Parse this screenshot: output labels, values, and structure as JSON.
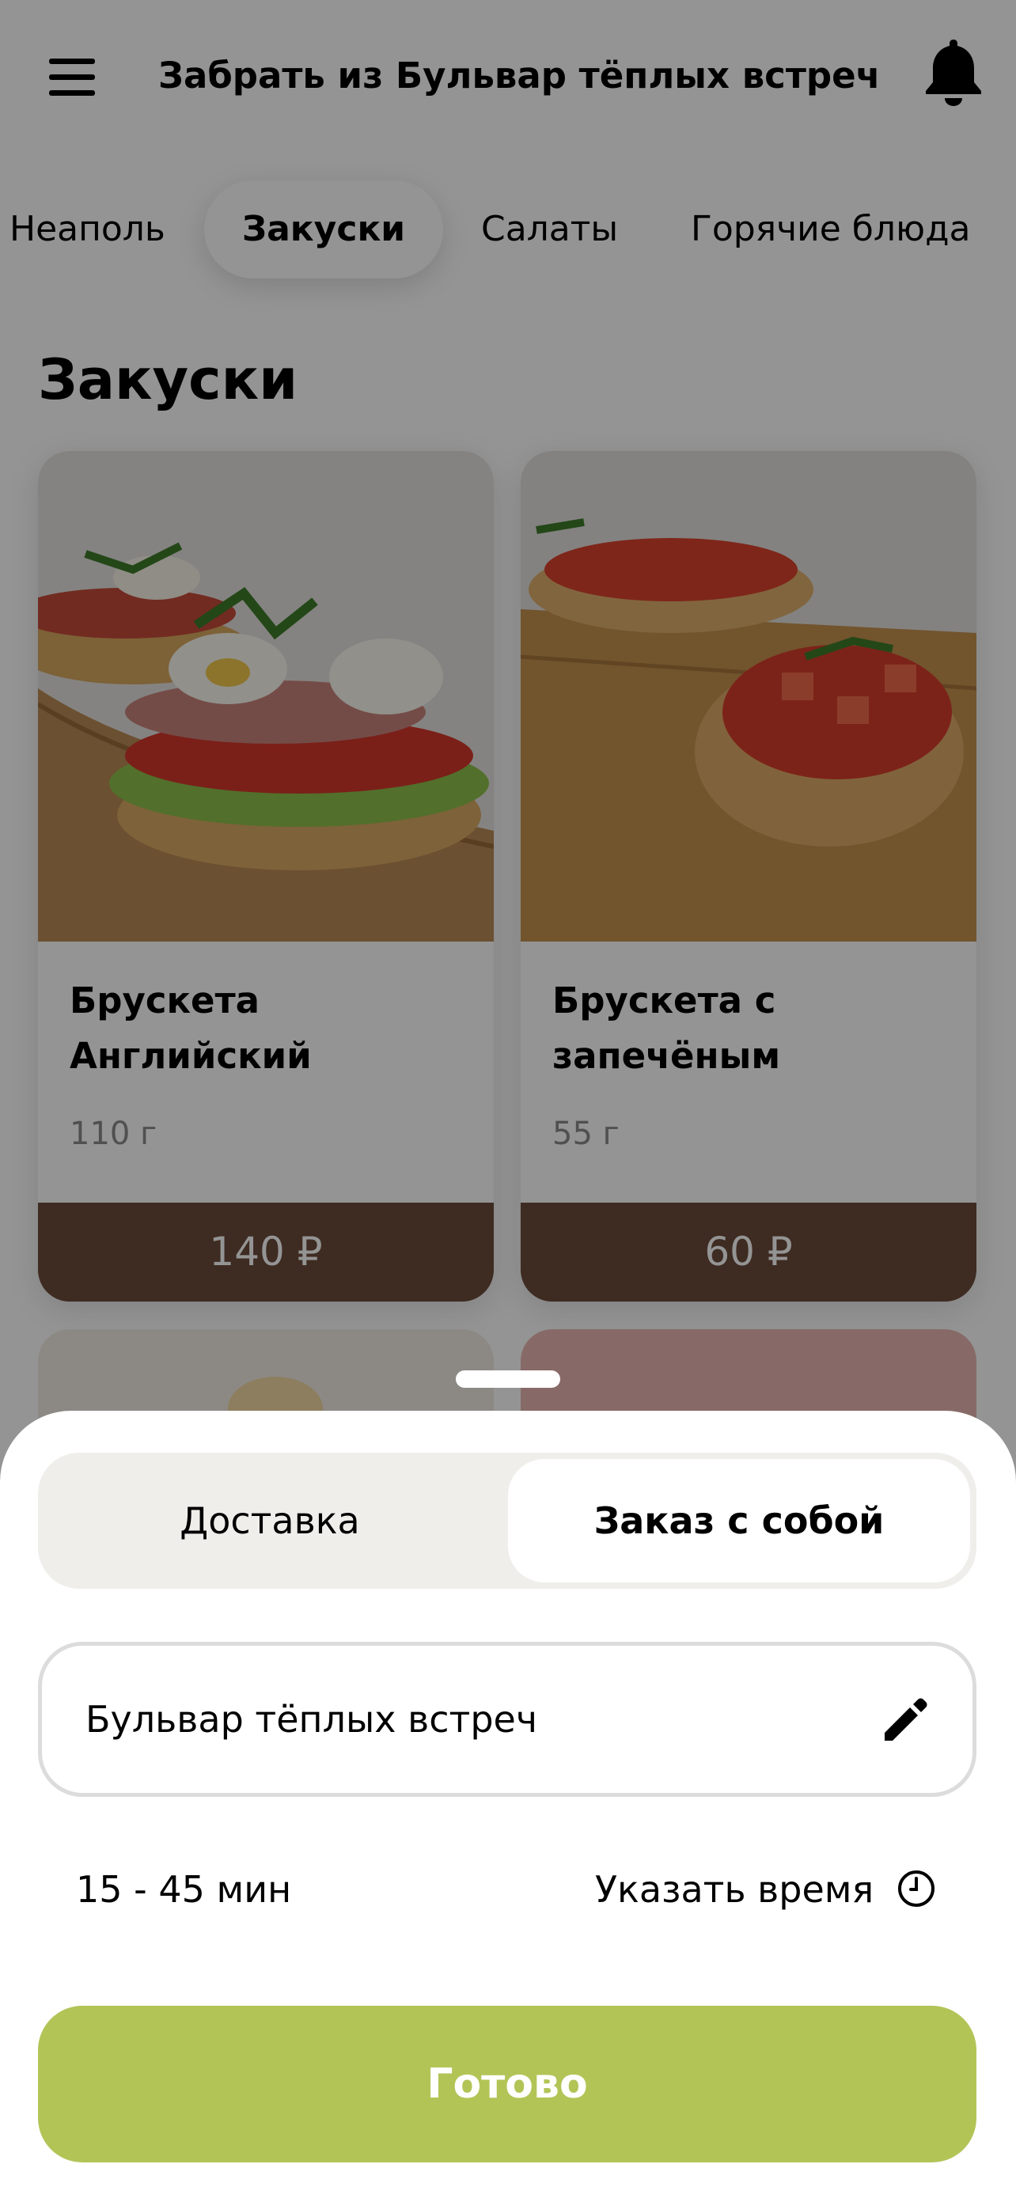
{
  "header": {
    "title": "Забрать из Бульвар тёплых встреч"
  },
  "categories": {
    "tabs": [
      {
        "label": "Неаполь"
      },
      {
        "label": "Закуски",
        "active": true
      },
      {
        "label": "Салаты"
      },
      {
        "label": "Горячие блюда"
      }
    ]
  },
  "section": {
    "title": "Закуски"
  },
  "products": [
    {
      "name": "Брускета Английский",
      "weight": "110 г",
      "price": "140 ₽"
    },
    {
      "name": "Брускета с запечёным",
      "weight": "55 г",
      "price": "60 ₽"
    }
  ],
  "sheet": {
    "mode_options": [
      {
        "label": "Доставка"
      },
      {
        "label": "Заказ с собой",
        "selected": true
      }
    ],
    "address": "Бульвар тёплых встреч",
    "eta": "15 - 45 мин",
    "time_link": "Указать время",
    "done_label": "Готово"
  },
  "colors": {
    "price_bar": "#6b4a3a",
    "accent_button": "#b3c457",
    "segment_bg": "#efeeea"
  }
}
